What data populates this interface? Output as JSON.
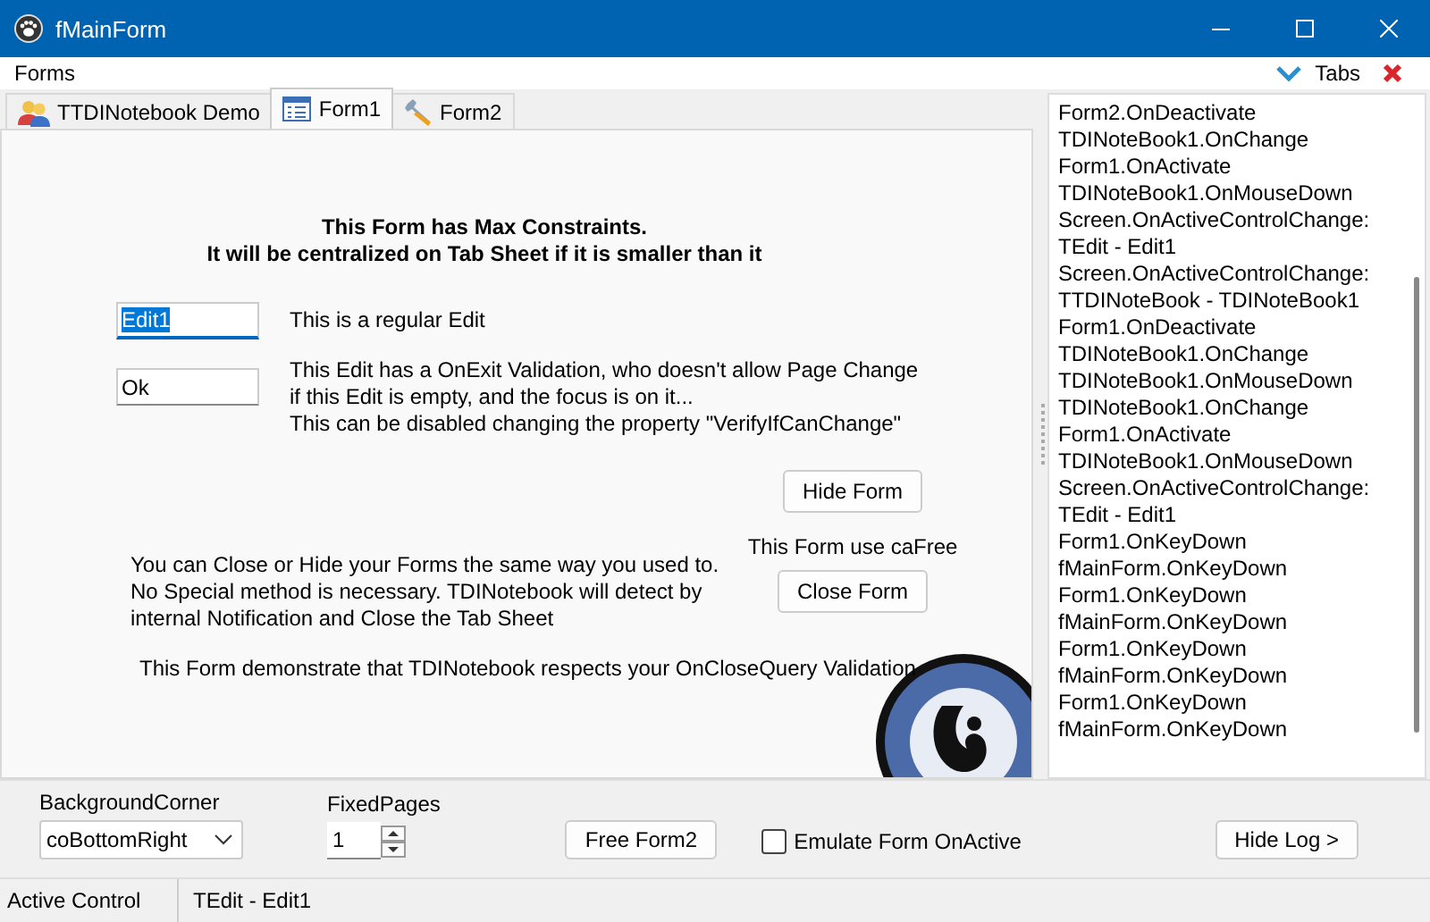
{
  "window": {
    "title": "fMainForm"
  },
  "menu": {
    "items": [
      "Forms"
    ],
    "tabs_toggle": "Tabs"
  },
  "tabs": [
    {
      "label": "TTDINotebook Demo",
      "selected": false
    },
    {
      "label": "Form1",
      "selected": true
    },
    {
      "label": "Form2",
      "selected": false
    }
  ],
  "form": {
    "heading": [
      "This Form has Max Constraints.",
      "It will be centralized on Tab Sheet if it is smaller than it"
    ],
    "edits": [
      {
        "value": "Edit1",
        "focused": true,
        "note": [
          "This is a regular Edit"
        ]
      },
      {
        "value": "Ok",
        "focused": false,
        "note": [
          "This Edit has a OnExit Validation, who doesn't  allow Page Change",
          " if this Edit is empty, and the focus is on it...",
          "This can be disabled  changing the property \"VerifyIfCanChange\""
        ]
      }
    ],
    "hide_button": "Hide Form",
    "close_caption": "This Form use caFree",
    "close_button": "Close Form",
    "close_note": [
      "You can Close or Hide your Forms the same way you used to.",
      "No Special method is necessary. TDINotebook will detect by",
      "internal Notification and Close the Tab Sheet"
    ],
    "query_note": "This Form demonstrate that TDINotebook respects your OnCloseQuery Validation",
    "background": {
      "kind": "picture"
    }
  },
  "log": [
    "Form2.OnDeactivate",
    "TDINoteBook1.OnChange",
    "Form1.OnActivate",
    "TDINoteBook1.OnMouseDown",
    "Screen.OnActiveControlChange:",
    "TEdit - Edit1",
    "Screen.OnActiveControlChange:",
    "TTDINoteBook - TDINoteBook1",
    "Form1.OnDeactivate",
    "TDINoteBook1.OnChange",
    "TDINoteBook1.OnMouseDown",
    "TDINoteBook1.OnChange",
    "Form1.OnActivate",
    "TDINoteBook1.OnMouseDown",
    "Screen.OnActiveControlChange:",
    "TEdit - Edit1",
    "Form1.OnKeyDown",
    "fMainForm.OnKeyDown",
    "Form1.OnKeyDown",
    "fMainForm.OnKeyDown",
    "Form1.OnKeyDown",
    "fMainForm.OnKeyDown",
    "Form1.OnKeyDown",
    "fMainForm.OnKeyDown"
  ],
  "bottom": {
    "corner_label": "BackgroundCorner",
    "corner_value": "coBottomRight",
    "pages_label": "FixedPages",
    "pages_value": "1",
    "free_button": "Free Form2",
    "emulate": {
      "label": "Emulate Form OnActive",
      "checked": false
    },
    "hide_log_button": "Hide Log >"
  },
  "status_bar": [
    "Active Control",
    "TEdit - Edit1"
  ]
}
